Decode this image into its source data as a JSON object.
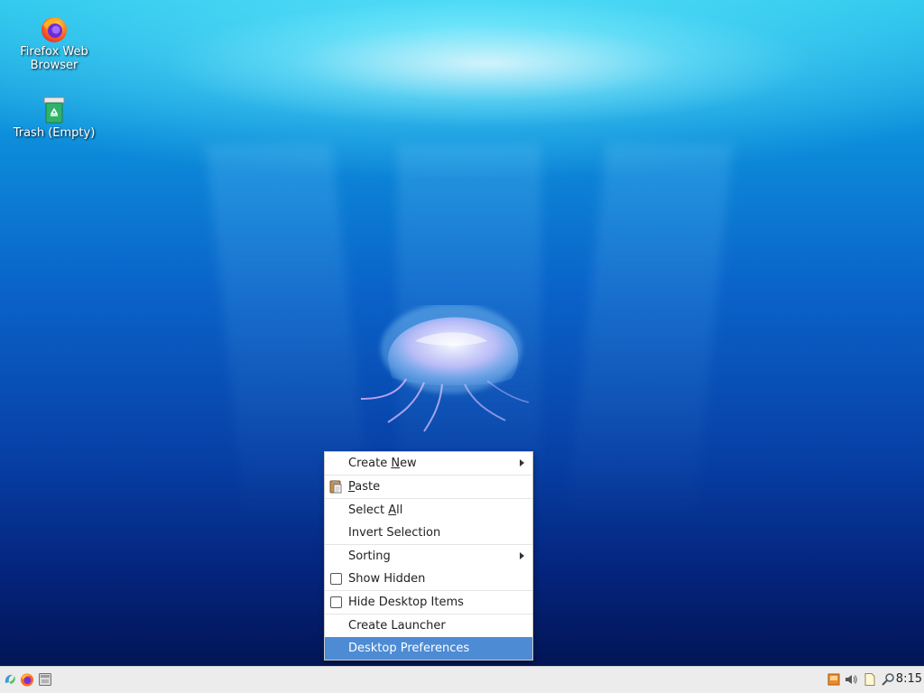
{
  "desktop": {
    "icons": [
      {
        "label_line1": "Firefox Web",
        "label_line2": "Browser",
        "icon": "firefox-icon"
      },
      {
        "label": "Trash (Empty)",
        "icon": "trash-icon"
      }
    ]
  },
  "context_menu": {
    "items": [
      {
        "before": "Create ",
        "mnemonic": "N",
        "after": "ew",
        "submenu": true
      },
      {
        "before": "",
        "mnemonic": "P",
        "after": "aste",
        "icon": "paste-icon"
      },
      {
        "before": "Select ",
        "mnemonic": "A",
        "after": "ll"
      },
      {
        "label": "Invert Selection"
      },
      {
        "label": "Sorting",
        "submenu": true
      },
      {
        "label": "Show Hidden",
        "checked": false
      },
      {
        "label": "Hide Desktop Items",
        "checked": false
      },
      {
        "label": "Create Launcher"
      },
      {
        "label": "Desktop Preferences",
        "highlighted": true
      }
    ]
  },
  "taskbar": {
    "launchers": [
      "app-menu-icon",
      "firefox-icon",
      "file-manager-icon"
    ],
    "tray": [
      "screen-icon",
      "volume-icon",
      "clipboard-icon",
      "search-icon"
    ],
    "clock": "8:15"
  },
  "colors": {
    "highlight": "#4d8bd4",
    "taskbar": "#ececec"
  }
}
